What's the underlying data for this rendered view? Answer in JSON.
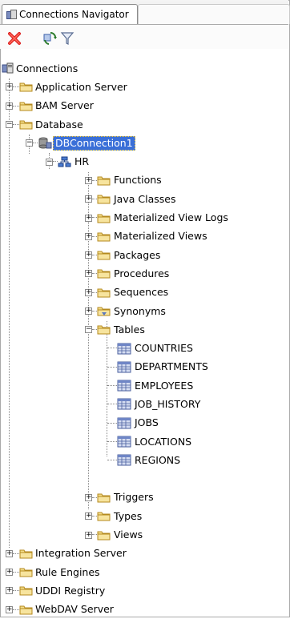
{
  "window": {
    "tab_label": "Connections Navigator"
  },
  "toolbar": {
    "delete_icon": "delete-icon",
    "refresh_icon": "refresh-icon",
    "filter_icon": "filter-icon"
  },
  "tree": {
    "root": "Connections",
    "app_server": "Application Server",
    "bam_server": "BAM Server",
    "database": "Database",
    "dbconnection": "DBConnection1",
    "hr": "HR",
    "functions": "Functions",
    "java_classes": "Java Classes",
    "mat_view_logs": "Materialized View Logs",
    "mat_views": "Materialized Views",
    "packages": "Packages",
    "procedures": "Procedures",
    "sequences": "Sequences",
    "synonyms": "Synonyms",
    "tables": "Tables",
    "countries": "COUNTRIES",
    "departments": "DEPARTMENTS",
    "employees": "EMPLOYEES",
    "job_history": "JOB_HISTORY",
    "jobs": "JOBS",
    "locations": "LOCATIONS",
    "regions": "REGIONS",
    "triggers": "Triggers",
    "types": "Types",
    "views": "Views",
    "integration_server": "Integration Server",
    "rule_engines": "Rule Engines",
    "uddi_registry": "UDDI Registry",
    "webdav_server": "WebDAV Server",
    "expand_symbol": "+",
    "collapse_symbol": "−"
  }
}
